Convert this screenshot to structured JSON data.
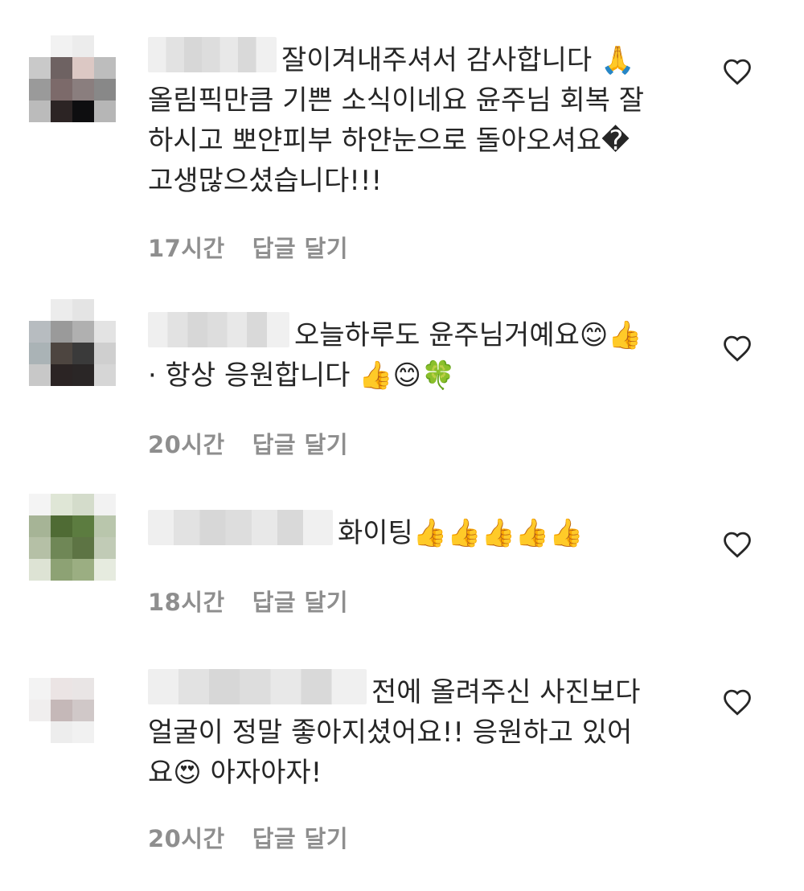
{
  "comments": [
    {
      "lines": [
        "잘이겨내주셔서 감사합니다 🙏",
        "올림픽만큼 기쁜 소식이네요 윤주님 회복 잘",
        "하시고 뽀얀피부 하얀눈으로 돌아오셔요�",
        "고생많으셨습니다!!!"
      ],
      "time": "17시간",
      "reply": "답글 달기",
      "avatar_colors": [
        "#ffffff",
        "#f2f2f2",
        "#ececec",
        "#ffffff",
        "#c9c9c9",
        "#6e6262",
        "#dcc8c4",
        "#bdbdbd",
        "#9a9a9a",
        "#7c6a6a",
        "#8a7e7e",
        "#888888",
        "#bbbbbb",
        "#2c2424",
        "#0e0e10",
        "#b6b6b6"
      ]
    },
    {
      "lines": [
        "오늘하루도 윤주님거예요😊👍",
        "· 항상 응원합니다 👍😊🍀"
      ],
      "time": "20시간",
      "reply": "답글 달기",
      "avatar_colors": [
        "#ffffff",
        "#ececec",
        "#e4e4e4",
        "#ffffff",
        "#b7bcc0",
        "#9a9a9a",
        "#b0b0b0",
        "#e3e3e3",
        "#aab3b6",
        "#4d4540",
        "#3a3a3a",
        "#cfcfcf",
        "#c8c8c8",
        "#2b2424",
        "#2a2626",
        "#d6d6d6"
      ]
    },
    {
      "lines": [
        "화이팅👍👍👍👍👍"
      ],
      "time": "18시간",
      "reply": "답글 달기",
      "avatar_colors": [
        "#f4f4f4",
        "#dfe6d6",
        "#d4dccb",
        "#f2f2f2",
        "#a6b496",
        "#4f6b34",
        "#5c7c40",
        "#b9c6ac",
        "#b5c0a6",
        "#6f8756",
        "#5d7444",
        "#c1cbb6",
        "#dde3d4",
        "#8da274",
        "#9bae82",
        "#e6ebdf"
      ]
    },
    {
      "lines": [
        "전에 올려주신 사진보다",
        "얼굴이 정말 좋아지셨어요!! 응원하고 있어",
        "요😍 아자아자!"
      ],
      "time": "20시간",
      "reply": "답글 달기",
      "avatar_colors": [
        "#ffffff",
        "#ffffff",
        "#ffffff",
        "#ffffff",
        "#f3f3f3",
        "#ebe4e4",
        "#e9e5e5",
        "#ffffff",
        "#f0eeee",
        "#c5b8b8",
        "#d0c8c8",
        "#ffffff",
        "#ffffff",
        "#ededed",
        "#f1f1f1",
        "#ffffff"
      ]
    }
  ],
  "heart_icon": "heart-outline-icon"
}
